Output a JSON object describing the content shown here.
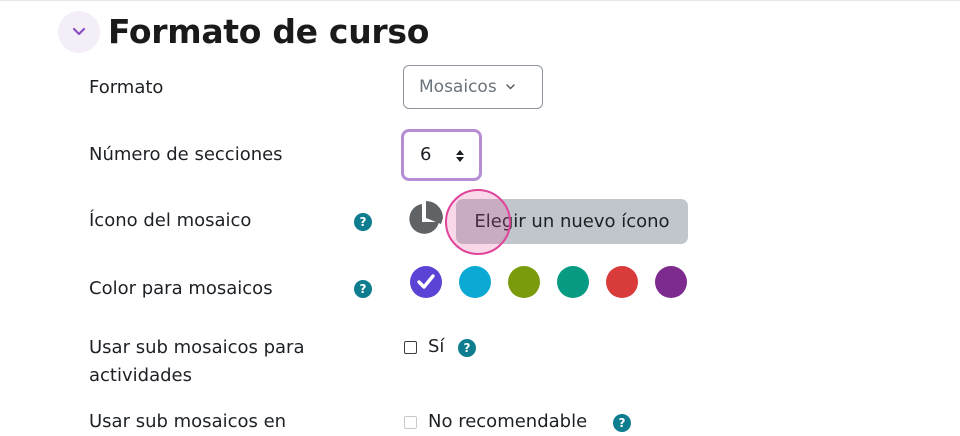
{
  "section": {
    "title": "Formato de curso"
  },
  "fields": {
    "format": {
      "label": "Formato",
      "value": "Mosaicos"
    },
    "sections": {
      "label": "Número de secciones",
      "value": "6"
    },
    "tile_icon": {
      "label": "Ícono del mosaico",
      "button_label": "Elegir un nuevo ícono",
      "help": "?"
    },
    "tile_color": {
      "label": "Color para mosaicos",
      "help": "?",
      "swatches": [
        "#5b43d6",
        "#0aa9d3",
        "#7a9b0c",
        "#079b84",
        "#d93a3a",
        "#7e2b8f"
      ],
      "selected_index": 0
    },
    "subtiles_activities": {
      "label_line1": "Usar sub mosaicos para",
      "label_line2": "actividades",
      "option": "Sí",
      "help": "?",
      "checked": false
    },
    "subtiles_in": {
      "label": "Usar sub mosaicos en",
      "option": "No recomendable",
      "help": "?",
      "checked": false,
      "disabled": true
    }
  },
  "colors": {
    "accent": "#b58ed6",
    "help_icon": "#0e7d8f",
    "click_highlight": "#e0449a"
  }
}
